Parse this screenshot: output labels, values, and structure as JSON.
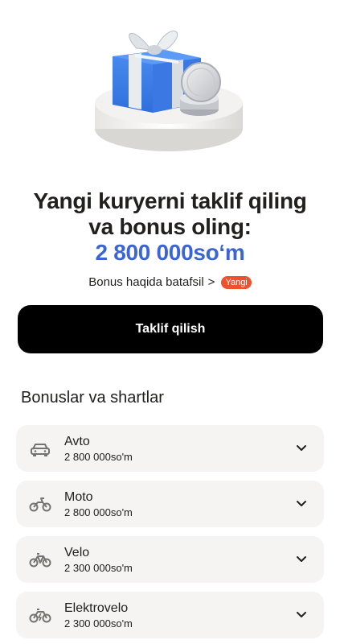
{
  "headline": {
    "line1": "Yangi kuryerni taklif qiling",
    "line2": "va bonus oling:",
    "amount": "2 800 000so‘m"
  },
  "bonus_link": {
    "label": "Bonus haqida batafsil",
    "chevron": ">",
    "badge": "Yangi"
  },
  "cta": {
    "label": "Taklif qilish"
  },
  "section": {
    "title": "Bonuslar va shartlar"
  },
  "cards": [
    {
      "name": "Avto",
      "amount": "2 800 000so'm",
      "icon": "car-icon"
    },
    {
      "name": "Moto",
      "amount": "2 800 000so'm",
      "icon": "motorbike-icon"
    },
    {
      "name": "Velo",
      "amount": "2 300 000so'm",
      "icon": "bicycle-icon"
    },
    {
      "name": "Elektrovelo",
      "amount": "2 300 000so'm",
      "icon": "electric-bicycle-icon"
    }
  ],
  "colors": {
    "accent": "#3b64d6",
    "badge": "#f0502b",
    "button": "#000000",
    "card_bg": "#f5f4f2"
  }
}
